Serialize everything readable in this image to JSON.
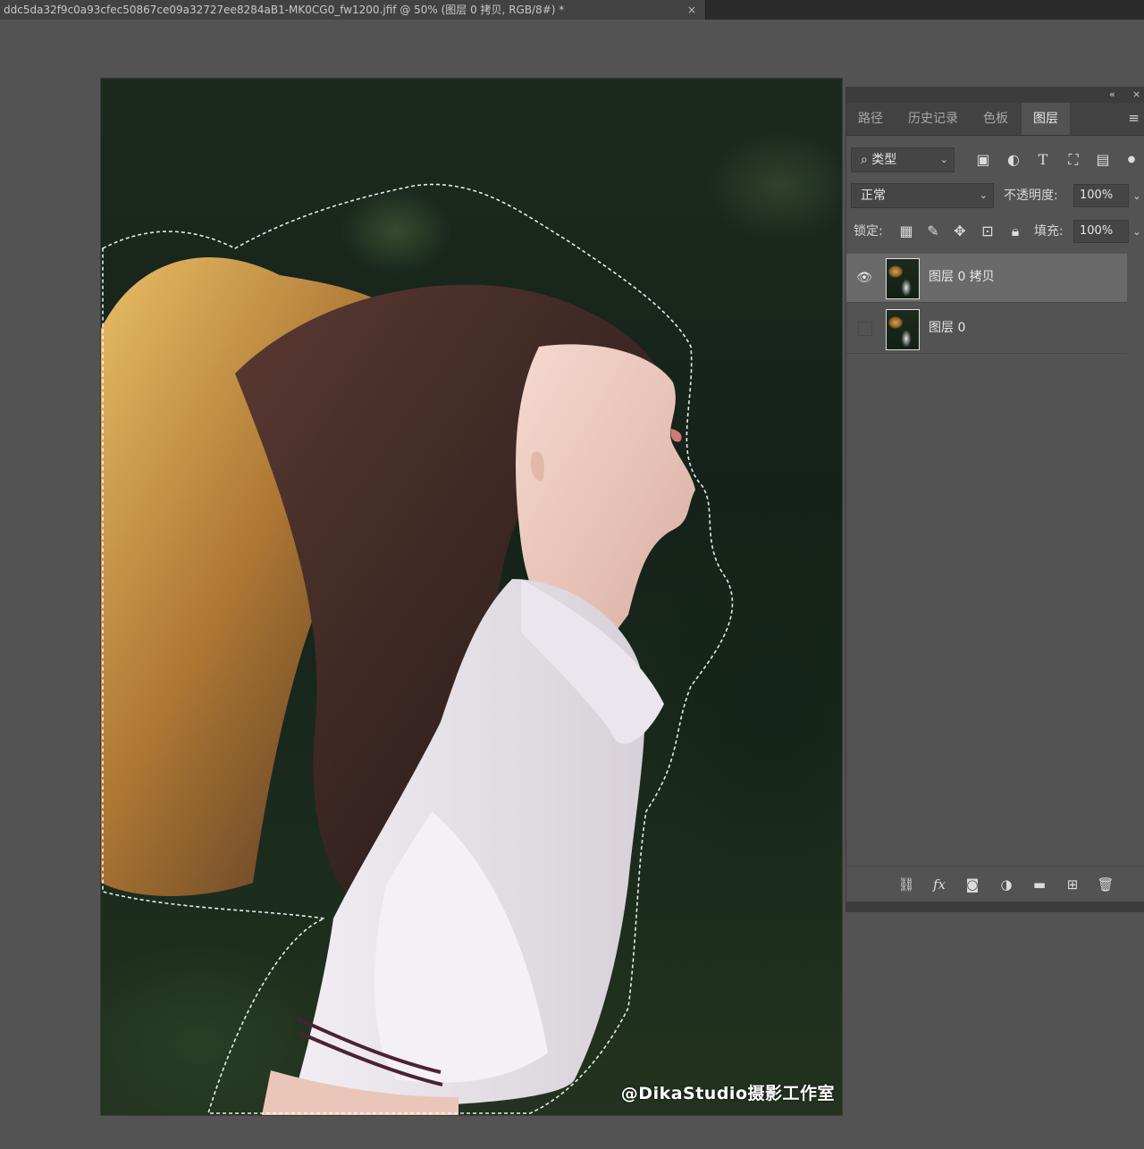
{
  "document_tab": {
    "title": "ddc5da32f9c0a93cfec50867ce09a32727ee8284aB1-MK0CG0_fw1200.jfif @ 50% (图层 0 拷贝, RGB/8#) *",
    "close": "×"
  },
  "canvas": {
    "watermark": "@DikaStudio摄影工作室"
  },
  "panel": {
    "collapse_icon": "«",
    "close_icon": "×",
    "tabs": [
      {
        "label": "路径",
        "active": false
      },
      {
        "label": "历史记录",
        "active": false
      },
      {
        "label": "色板",
        "active": false
      },
      {
        "label": "图层",
        "active": true
      }
    ],
    "menu_icon": "≡",
    "filter": {
      "kind_label": "类型",
      "icons": [
        "image-filter-icon",
        "adjustment-filter-icon",
        "type-filter-icon",
        "shape-filter-icon",
        "smart-object-filter-icon"
      ]
    },
    "blend": {
      "mode": "正常",
      "opacity_label": "不透明度:",
      "opacity_value": "100%"
    },
    "lock": {
      "label": "锁定:",
      "fill_label": "填充:",
      "fill_value": "100%",
      "icons": [
        "lock-transparent-icon",
        "lock-image-icon",
        "lock-position-icon",
        "lock-artboard-icon",
        "lock-all-icon"
      ]
    },
    "layers": [
      {
        "name": "图层 0 拷贝",
        "visible": true,
        "selected": true
      },
      {
        "name": "图层 0",
        "visible": false,
        "selected": false
      }
    ],
    "bottom_icons": [
      "link-icon",
      "fx-icon",
      "mask-icon",
      "adjustment-icon",
      "folder-icon",
      "new-layer-icon",
      "trash-icon"
    ],
    "fx_label": "fx"
  },
  "colors": {
    "workspace": "#535353",
    "panel_dark": "#424242",
    "selected_layer": "#6a6a6a"
  }
}
